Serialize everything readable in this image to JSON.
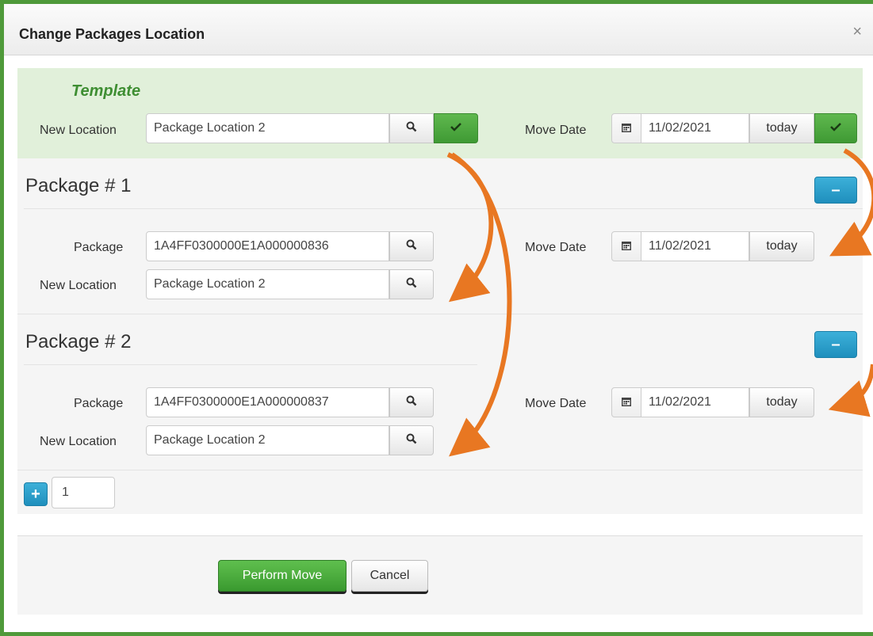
{
  "dialog": {
    "title": "Change Packages Location",
    "close_label": "×"
  },
  "template": {
    "title": "Template",
    "new_location_label": "New Location",
    "new_location_value": "Package Location 2",
    "move_date_label": "Move Date",
    "move_date_value": "11/02/2021",
    "today_label": "today"
  },
  "packages": [
    {
      "title": "Package # 1",
      "package_label": "Package",
      "package_value": "1A4FF0300000E1A000000836",
      "new_location_label": "New Location",
      "new_location_value": "Package Location 2",
      "move_date_label": "Move Date",
      "move_date_value": "11/02/2021",
      "today_label": "today"
    },
    {
      "title": "Package # 2",
      "package_label": "Package",
      "package_value": "1A4FF0300000E1A000000837",
      "new_location_label": "New Location",
      "new_location_value": "Package Location 2",
      "move_date_label": "Move Date",
      "move_date_value": "11/02/2021",
      "today_label": "today"
    }
  ],
  "add_count": "1",
  "actions": {
    "perform_label": "Perform Move",
    "cancel_label": "Cancel"
  },
  "colors": {
    "frame": "#4f9a3a",
    "template_bg": "#e1f0da",
    "accent_green": "#3f9a34",
    "accent_blue": "#1f8fbd",
    "arrow": "#e87722"
  },
  "icons": {
    "search": "search-icon",
    "check": "check-icon",
    "calendar": "calendar-icon",
    "minus": "minus-icon",
    "plus": "plus-icon"
  }
}
